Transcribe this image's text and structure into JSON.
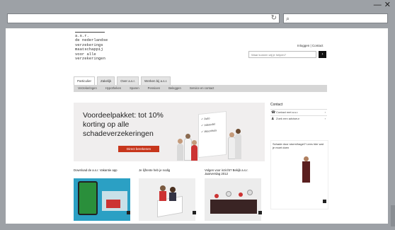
{
  "window": {
    "minimize_glyph": "—",
    "close_glyph": "✕"
  },
  "browser": {
    "address_value": "",
    "refresh_icon": "refresh-icon",
    "search_value": ""
  },
  "site": {
    "logo_lines": [
      "a.s.r.",
      "de nederlandse",
      "verzekerings",
      "maatschappij",
      "voor alle",
      "verzekeringen"
    ],
    "toplinks": "Inloggen | Contact",
    "search_placeholder": "Waar kunnen wij je helpen?",
    "search_button": "›",
    "tabs": [
      "Particulier",
      "Zakelijk",
      "Over a.s.r.",
      "Werken bij a.s.r."
    ],
    "subnav": [
      "Verzekeringen",
      "Hypotheken",
      "Sparen",
      "Pensioen",
      "Beleggen",
      "Service en contact"
    ],
    "hero": {
      "headline": "Voordeelpakket: tot 10% korting op alle schadeverzekeringen",
      "cta": "Direct berekenen",
      "board_items": [
        "✓ Auto",
        "✓ Inboedel",
        "✓ Woonhuis"
      ]
    },
    "contact": {
      "title": "Contact",
      "rows": [
        "Contact met a.s.r.",
        "Zoek een adviseur"
      ]
    },
    "promo": {
      "text": "Schade door storm/hagel? Lees hier wat je moet doen"
    },
    "columns": [
      {
        "title": "Download de a.s.r. Vakantie app"
      },
      {
        "title": "Je lijfrente heb je nodig"
      },
      {
        "title": "Volgen voor inzicht? Bekijk a.s.r. Jaarverslag 2012"
      }
    ]
  }
}
